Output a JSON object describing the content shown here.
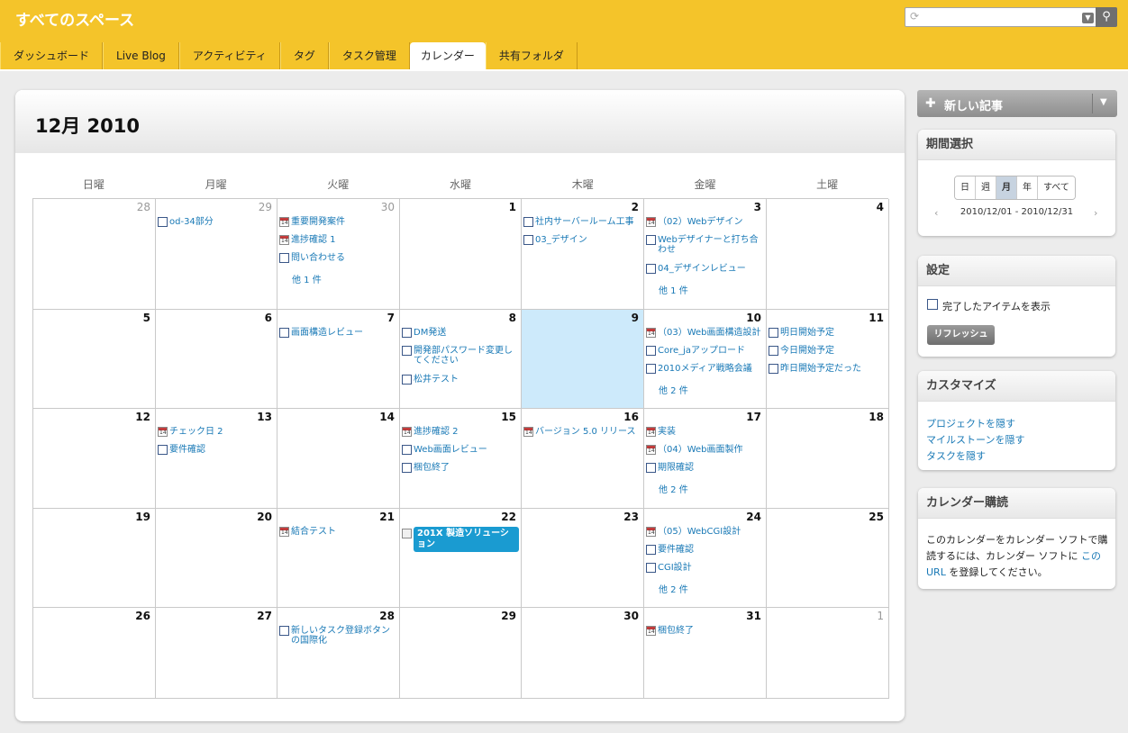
{
  "header": {
    "space_title": "すべてのスペース",
    "search_placeholder": "",
    "search_spinner_icon": "refresh-icon",
    "search_icon": "search-icon"
  },
  "tabs": [
    "ダッシュボード",
    "Live Blog",
    "アクティビティ",
    "タグ",
    "タスク管理",
    "カレンダー",
    "共有フォルダ"
  ],
  "active_tab": 5,
  "calendar": {
    "title": "12月 2010",
    "weekdays": [
      "日曜",
      "月曜",
      "火曜",
      "水曜",
      "木曜",
      "金曜",
      "土曜"
    ],
    "today": "9",
    "weeks": [
      [
        {
          "day": "28",
          "other": true,
          "events": []
        },
        {
          "day": "29",
          "other": true,
          "events": [
            {
              "icon": "checkbox",
              "text": "od-34部分"
            }
          ]
        },
        {
          "day": "30",
          "other": true,
          "events": [
            {
              "icon": "calendar",
              "text": "重要開発案件"
            },
            {
              "icon": "calendar",
              "text": "進捗確認 1"
            },
            {
              "icon": "checkbox",
              "text": "問い合わせる"
            }
          ],
          "more": "他 1 件"
        },
        {
          "day": "1",
          "events": []
        },
        {
          "day": "2",
          "events": [
            {
              "icon": "checkbox",
              "text": "社内サーバールーム工事"
            },
            {
              "icon": "checkbox",
              "text": "03_デザイン"
            }
          ]
        },
        {
          "day": "3",
          "events": [
            {
              "icon": "calendar",
              "text": "（02）Webデザイン"
            },
            {
              "icon": "checkbox",
              "text": "Webデザイナーと打ち合わせ",
              "lines": 2
            },
            {
              "icon": "checkbox",
              "text": "04_デザインレビュー"
            }
          ],
          "more": "他 1 件"
        },
        {
          "day": "4",
          "events": []
        }
      ],
      [
        {
          "day": "5",
          "events": []
        },
        {
          "day": "6",
          "events": []
        },
        {
          "day": "7",
          "events": [
            {
              "icon": "checkbox",
              "text": "画面構造レビュー"
            }
          ]
        },
        {
          "day": "8",
          "events": [
            {
              "icon": "checkbox",
              "text": "DM発送"
            },
            {
              "icon": "checkbox",
              "text": "開発部パスワード変更してください",
              "lines": 2
            },
            {
              "icon": "checkbox",
              "text": "松井テスト"
            }
          ]
        },
        {
          "day": "9",
          "events": []
        },
        {
          "day": "10",
          "events": [
            {
              "icon": "calendar",
              "text": "（03）Web画面構造設計"
            },
            {
              "icon": "checkbox",
              "text": "Core_jaアップロード"
            },
            {
              "icon": "checkbox",
              "text": "2010メディア戦略会議"
            }
          ],
          "more": "他 2 件"
        },
        {
          "day": "11",
          "events": [
            {
              "icon": "checkbox",
              "text": "明日開始予定"
            },
            {
              "icon": "checkbox",
              "text": "今日開始予定"
            },
            {
              "icon": "checkbox",
              "text": "昨日開始予定だった"
            }
          ]
        }
      ],
      [
        {
          "day": "12",
          "events": []
        },
        {
          "day": "13",
          "events": [
            {
              "icon": "calendar",
              "text": "チェック日 2"
            },
            {
              "icon": "checkbox",
              "text": "要件確認"
            }
          ]
        },
        {
          "day": "14",
          "events": []
        },
        {
          "day": "15",
          "events": [
            {
              "icon": "calendar",
              "text": "進捗確認 2"
            },
            {
              "icon": "checkbox",
              "text": "Web画面レビュー"
            },
            {
              "icon": "checkbox",
              "text": "梱包終了"
            }
          ]
        },
        {
          "day": "16",
          "events": [
            {
              "icon": "calendar",
              "text": "バージョン 5.0 リリース"
            }
          ]
        },
        {
          "day": "17",
          "events": [
            {
              "icon": "calendar",
              "text": "実装"
            },
            {
              "icon": "calendar",
              "text": "（04）Web画面製作"
            },
            {
              "icon": "checkbox",
              "text": "期限確認"
            }
          ],
          "more": "他 2 件"
        },
        {
          "day": "18",
          "events": []
        }
      ],
      [
        {
          "day": "19",
          "events": []
        },
        {
          "day": "20",
          "events": []
        },
        {
          "day": "21",
          "events": [
            {
              "icon": "calendar",
              "text": "結合テスト"
            }
          ]
        },
        {
          "day": "22",
          "events": [],
          "milestone": "201X 製造ソリューション"
        },
        {
          "day": "23",
          "events": []
        },
        {
          "day": "24",
          "events": [
            {
              "icon": "calendar",
              "text": "（05）WebCGI設計"
            },
            {
              "icon": "checkbox",
              "text": "要件確認"
            },
            {
              "icon": "checkbox",
              "text": "CGI設計"
            }
          ],
          "more": "他 2 件"
        },
        {
          "day": "25",
          "events": []
        }
      ],
      [
        {
          "day": "26",
          "events": []
        },
        {
          "day": "27",
          "events": []
        },
        {
          "day": "28",
          "events": [
            {
              "icon": "checkbox",
              "text": "新しいタスク登録ボタンの国際化",
              "lines": 2
            }
          ]
        },
        {
          "day": "29",
          "events": []
        },
        {
          "day": "30",
          "events": []
        },
        {
          "day": "31",
          "events": [
            {
              "icon": "calendar",
              "text": "梱包終了"
            }
          ]
        },
        {
          "day": "1",
          "other": true,
          "events": []
        }
      ]
    ]
  },
  "sidebar": {
    "new_post": {
      "label": "新しい記事",
      "icon": "plus-icon",
      "dropdown_icon": "chevron-down-icon"
    },
    "period": {
      "title": "期間選択",
      "buttons": [
        "日",
        "週",
        "月",
        "年",
        "すべて"
      ],
      "selected": 2,
      "range": "2010/12/01 - 2010/12/31",
      "prev": "‹",
      "next": "›"
    },
    "settings": {
      "title": "設定",
      "checkbox_label": "完了したアイテムを表示",
      "refresh_label": "リフレッシュ"
    },
    "customize": {
      "title": "カスタマイズ",
      "links": [
        "プロジェクトを隠す",
        "マイルストーンを隠す",
        "タスクを隠す"
      ]
    },
    "subscribe": {
      "title": "カレンダー購読",
      "text_line1": "このカレンダーをカレンダー ソフトで購",
      "text_line2a": "読するには、カレンダー ソフトに ",
      "link_a": "この",
      "link_b": "URL",
      "text_line3b": " を登録してください。"
    }
  }
}
